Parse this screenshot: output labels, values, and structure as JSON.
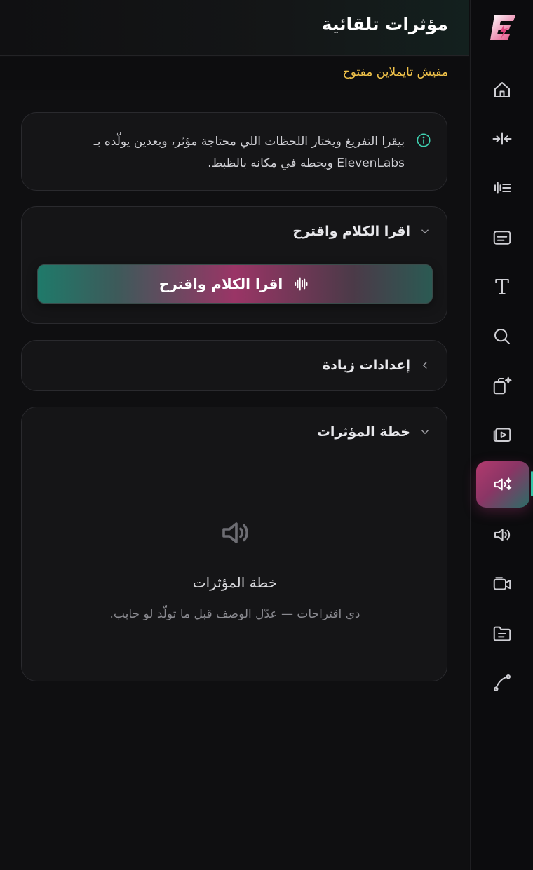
{
  "header": {
    "title": "مؤثرات تلقائية"
  },
  "timeline_status": "مفيش تايملاين مفتوح",
  "info": {
    "text": "بيقرا التفريغ ويختار اللحظات اللي محتاجة مؤثر، وبعدين يولّده بـ ElevenLabs ويحطه في مكانه بالظبط.",
    "icon": "info-icon"
  },
  "read_section": {
    "heading": "اقرا الكلام واقترح",
    "button_label": "اقرا الكلام واقترح",
    "button_icon": "waveform-icon",
    "expanded": true
  },
  "settings_section": {
    "heading": "إعدادات زيادة",
    "expanded": false
  },
  "plan_section": {
    "heading": "خطة المؤثرات",
    "expanded": true,
    "empty_title": "خطة المؤثرات",
    "empty_desc": "دي اقتراحات — عدّل الوصف قبل ما تولّد لو حابب."
  },
  "rail": {
    "items": [
      "home-icon",
      "split-icon",
      "audio-lines-icon",
      "captions-icon",
      "text-icon",
      "search-icon",
      "magic-layers-icon",
      "media-library-icon",
      "auto-sfx-icon",
      "volume-icon",
      "camera-icon",
      "folder-icon",
      "curve-icon"
    ],
    "active": "auto-sfx-icon"
  },
  "colors": {
    "accent": "#b23a6e",
    "teal": "#1f7a6a",
    "warning": "#f0c24a"
  }
}
